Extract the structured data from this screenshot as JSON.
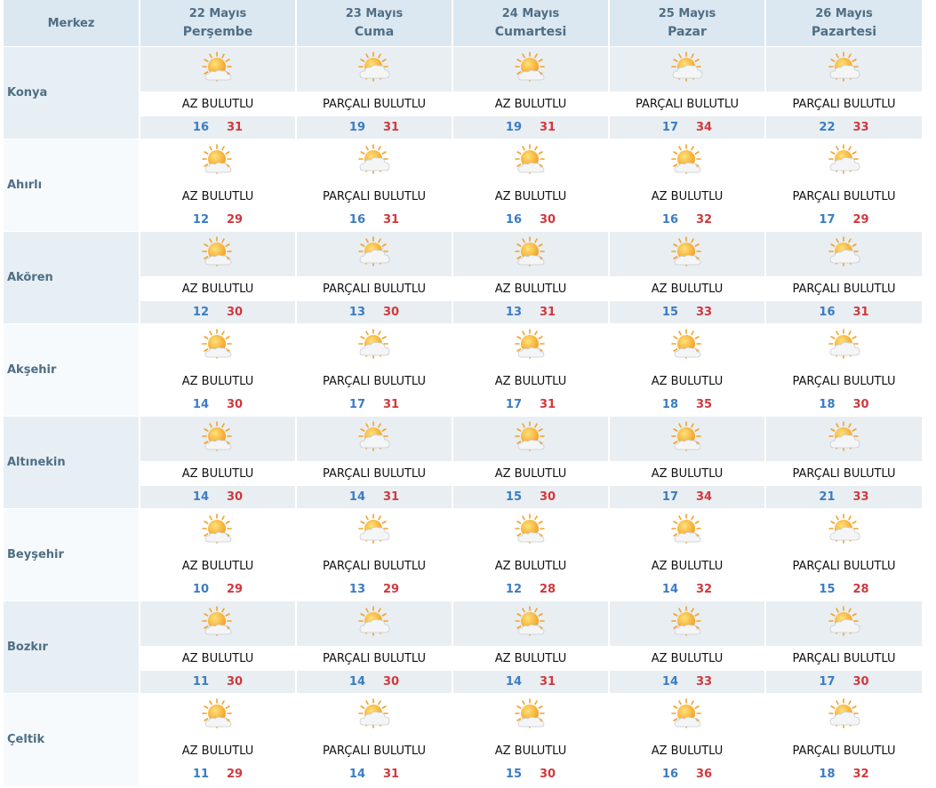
{
  "header": {
    "corner_label": "Merkez",
    "days": [
      {
        "date": "22 Mayıs",
        "name": "Perşembe"
      },
      {
        "date": "23 Mayıs",
        "name": "Cuma"
      },
      {
        "date": "24 Mayıs",
        "name": "Cumartesi"
      },
      {
        "date": "25 Mayıs",
        "name": "Pazar"
      },
      {
        "date": "26 Mayıs",
        "name": "Pazartesi"
      }
    ]
  },
  "icons": {
    "az": "partly-sunny-icon",
    "parcali": "mostly-cloudy-icon"
  },
  "colors": {
    "min_temp": "#3a7cc3",
    "max_temp": "#d0393d",
    "header_text": "#4f6e84"
  },
  "rows": [
    {
      "place": "Konya",
      "days": [
        {
          "icon": "az",
          "desc": "AZ BULUTLU",
          "min": "16",
          "max": "31"
        },
        {
          "icon": "parcali",
          "desc": "PARÇALI BULUTLU",
          "min": "19",
          "max": "31"
        },
        {
          "icon": "az",
          "desc": "AZ BULUTLU",
          "min": "19",
          "max": "31"
        },
        {
          "icon": "parcali",
          "desc": "PARÇALI BULUTLU",
          "min": "17",
          "max": "34"
        },
        {
          "icon": "parcali",
          "desc": "PARÇALI BULUTLU",
          "min": "22",
          "max": "33"
        }
      ]
    },
    {
      "place": "Ahırlı",
      "days": [
        {
          "icon": "az",
          "desc": "AZ BULUTLU",
          "min": "12",
          "max": "29"
        },
        {
          "icon": "parcali",
          "desc": "PARÇALI BULUTLU",
          "min": "16",
          "max": "31"
        },
        {
          "icon": "az",
          "desc": "AZ BULUTLU",
          "min": "16",
          "max": "30"
        },
        {
          "icon": "az",
          "desc": "AZ BULUTLU",
          "min": "16",
          "max": "32"
        },
        {
          "icon": "parcali",
          "desc": "PARÇALI BULUTLU",
          "min": "17",
          "max": "29"
        }
      ]
    },
    {
      "place": "Akören",
      "days": [
        {
          "icon": "az",
          "desc": "AZ BULUTLU",
          "min": "12",
          "max": "30"
        },
        {
          "icon": "parcali",
          "desc": "PARÇALI BULUTLU",
          "min": "13",
          "max": "30"
        },
        {
          "icon": "az",
          "desc": "AZ BULUTLU",
          "min": "13",
          "max": "31"
        },
        {
          "icon": "az",
          "desc": "AZ BULUTLU",
          "min": "15",
          "max": "33"
        },
        {
          "icon": "parcali",
          "desc": "PARÇALI BULUTLU",
          "min": "16",
          "max": "31"
        }
      ]
    },
    {
      "place": "Akşehir",
      "days": [
        {
          "icon": "az",
          "desc": "AZ BULUTLU",
          "min": "14",
          "max": "30"
        },
        {
          "icon": "parcali",
          "desc": "PARÇALI BULUTLU",
          "min": "17",
          "max": "31"
        },
        {
          "icon": "az",
          "desc": "AZ BULUTLU",
          "min": "17",
          "max": "31"
        },
        {
          "icon": "az",
          "desc": "AZ BULUTLU",
          "min": "18",
          "max": "35"
        },
        {
          "icon": "parcali",
          "desc": "PARÇALI BULUTLU",
          "min": "18",
          "max": "30"
        }
      ]
    },
    {
      "place": "Altınekin",
      "days": [
        {
          "icon": "az",
          "desc": "AZ BULUTLU",
          "min": "14",
          "max": "30"
        },
        {
          "icon": "parcali",
          "desc": "PARÇALI BULUTLU",
          "min": "14",
          "max": "31"
        },
        {
          "icon": "az",
          "desc": "AZ BULUTLU",
          "min": "15",
          "max": "30"
        },
        {
          "icon": "az",
          "desc": "AZ BULUTLU",
          "min": "17",
          "max": "34"
        },
        {
          "icon": "parcali",
          "desc": "PARÇALI BULUTLU",
          "min": "21",
          "max": "33"
        }
      ]
    },
    {
      "place": "Beyşehir",
      "days": [
        {
          "icon": "az",
          "desc": "AZ BULUTLU",
          "min": "10",
          "max": "29"
        },
        {
          "icon": "parcali",
          "desc": "PARÇALI BULUTLU",
          "min": "13",
          "max": "29"
        },
        {
          "icon": "az",
          "desc": "AZ BULUTLU",
          "min": "12",
          "max": "28"
        },
        {
          "icon": "az",
          "desc": "AZ BULUTLU",
          "min": "14",
          "max": "32"
        },
        {
          "icon": "parcali",
          "desc": "PARÇALI BULUTLU",
          "min": "15",
          "max": "28"
        }
      ]
    },
    {
      "place": "Bozkır",
      "days": [
        {
          "icon": "az",
          "desc": "AZ BULUTLU",
          "min": "11",
          "max": "30"
        },
        {
          "icon": "parcali",
          "desc": "PARÇALI BULUTLU",
          "min": "14",
          "max": "30"
        },
        {
          "icon": "az",
          "desc": "AZ BULUTLU",
          "min": "14",
          "max": "31"
        },
        {
          "icon": "az",
          "desc": "AZ BULUTLU",
          "min": "14",
          "max": "33"
        },
        {
          "icon": "parcali",
          "desc": "PARÇALI BULUTLU",
          "min": "17",
          "max": "30"
        }
      ]
    },
    {
      "place": "Çeltik",
      "days": [
        {
          "icon": "az",
          "desc": "AZ BULUTLU",
          "min": "11",
          "max": "29"
        },
        {
          "icon": "parcali",
          "desc": "PARÇALI BULUTLU",
          "min": "14",
          "max": "31"
        },
        {
          "icon": "az",
          "desc": "AZ BULUTLU",
          "min": "15",
          "max": "30"
        },
        {
          "icon": "az",
          "desc": "AZ BULUTLU",
          "min": "16",
          "max": "36"
        },
        {
          "icon": "parcali",
          "desc": "PARÇALI BULUTLU",
          "min": "18",
          "max": "32"
        }
      ]
    }
  ]
}
